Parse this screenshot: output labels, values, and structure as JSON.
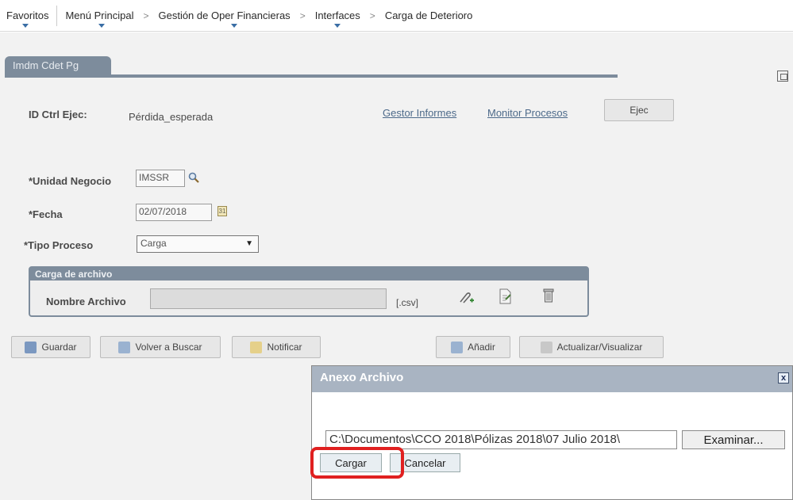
{
  "nav": {
    "favorites": "Favoritos",
    "main_menu": "Menú Principal",
    "sep": ">",
    "item1": "Gestión de Oper Financieras",
    "item2": "Interfaces",
    "item3": "Carga de Deterioro"
  },
  "tab": {
    "label": "Imdm Cdet Pg"
  },
  "run": {
    "id_label": "ID Ctrl Ejec:",
    "id_value": "Pérdida_esperada",
    "report_manager": "Gestor Informes",
    "process_monitor": "Monitor Procesos",
    "run_button": "Ejec"
  },
  "form": {
    "bu_label": "*Unidad Negocio",
    "bu_value": "IMSSR",
    "date_label": "*Fecha",
    "date_value": "02/07/2018",
    "date_icon_text": "31",
    "type_label": "*Tipo Proceso",
    "type_value": "Carga"
  },
  "upload": {
    "title": "Carga de archivo",
    "file_label": "Nombre Archivo",
    "ext": "[.csv]"
  },
  "actions": {
    "save": "Guardar",
    "back": "Volver a Buscar",
    "notify": "Notificar",
    "add": "Añadir",
    "update": "Actualizar/Visualizar"
  },
  "modal": {
    "title": "Anexo Archivo",
    "close": "x",
    "path": "C:\\Documentos\\CCO 2018\\Pólizas 2018\\07 Julio 2018\\",
    "browse": "Examinar...",
    "upload": "Cargar",
    "cancel": "Cancelar"
  },
  "colors": {
    "tab": "#7d8c9c",
    "modal_header": "#a9b4c2",
    "highlight": "#e02020"
  }
}
